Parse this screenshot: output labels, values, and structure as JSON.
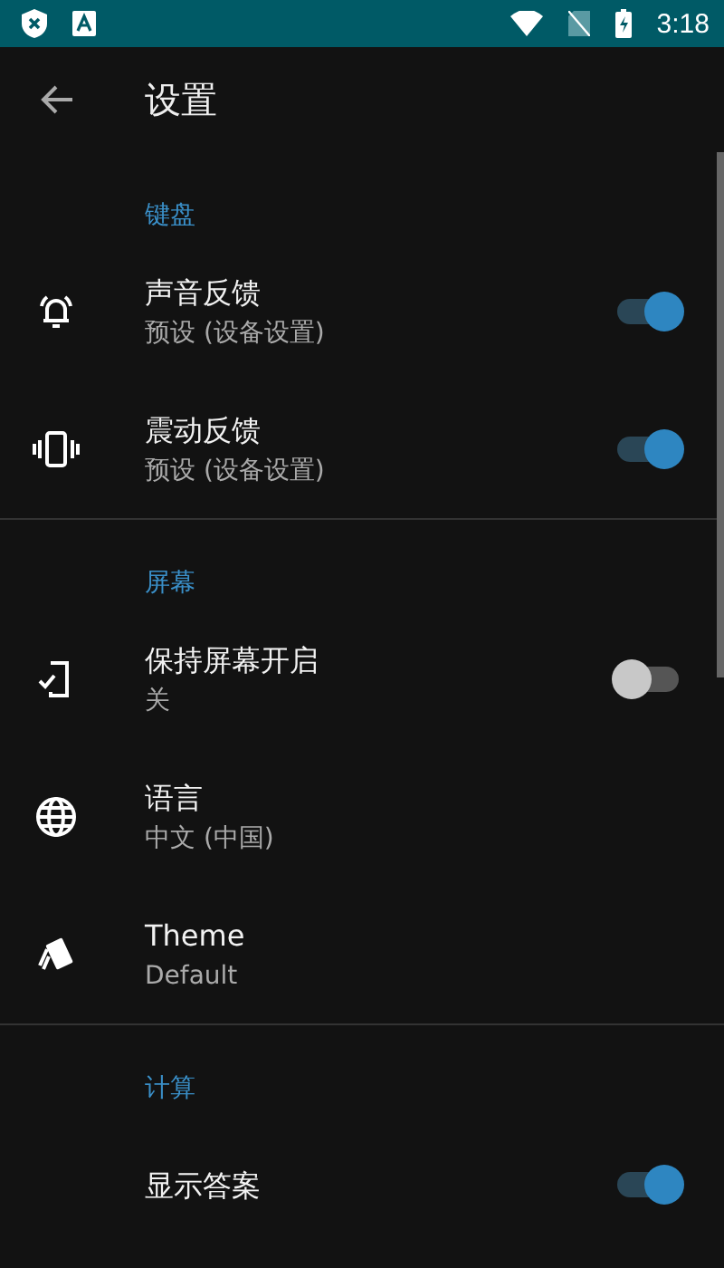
{
  "status_bar": {
    "time": "3:18"
  },
  "toolbar": {
    "title": "设置"
  },
  "sections": [
    {
      "title": "键盘",
      "items": [
        {
          "kind": "toggle",
          "title": "声音反馈",
          "summary": "预设 (设备设置)",
          "checked": true
        },
        {
          "kind": "toggle",
          "title": "震动反馈",
          "summary": "预设 (设备设置)",
          "checked": true
        }
      ]
    },
    {
      "title": "屏幕",
      "items": [
        {
          "kind": "toggle",
          "title": "保持屏幕开启",
          "summary": "关",
          "checked": false
        },
        {
          "kind": "plain",
          "title": "语言",
          "summary": "中文 (中国)"
        },
        {
          "kind": "plain",
          "title": "Theme",
          "summary": "Default"
        }
      ]
    },
    {
      "title": "计算",
      "items": [
        {
          "kind": "toggle",
          "title": "显示答案",
          "checked": true
        }
      ]
    }
  ]
}
